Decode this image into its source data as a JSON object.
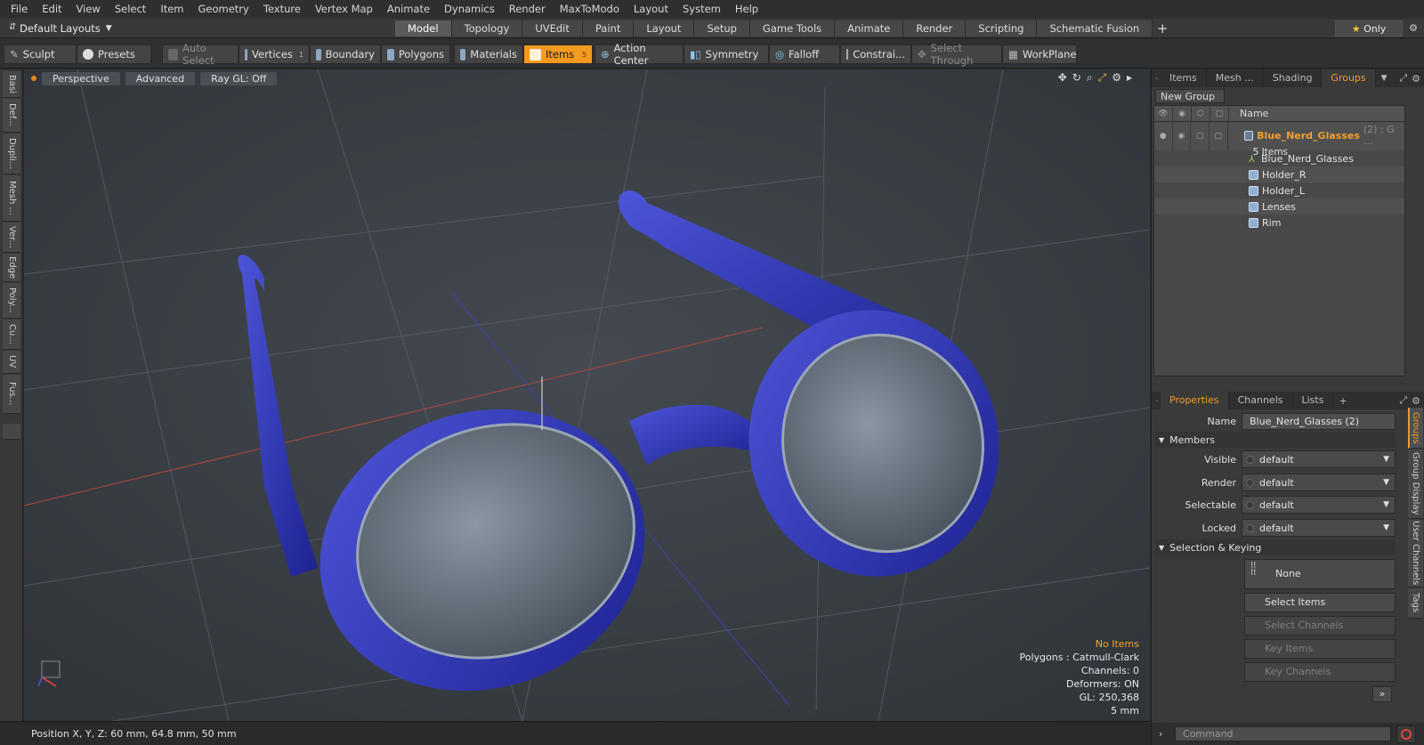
{
  "menu": [
    "File",
    "Edit",
    "View",
    "Select",
    "Item",
    "Geometry",
    "Texture",
    "Vertex Map",
    "Animate",
    "Dynamics",
    "Render",
    "MaxToModo",
    "Layout",
    "System",
    "Help"
  ],
  "layouts": {
    "label": "Default Layouts"
  },
  "mode_tabs": [
    "Model",
    "Topology",
    "UVEdit",
    "Paint",
    "Layout",
    "Setup",
    "Game Tools",
    "Animate",
    "Render",
    "Scripting",
    "Schematic Fusion"
  ],
  "only_label": "Only",
  "toolbar": {
    "sculpt": "Sculpt",
    "presets": "Presets",
    "auto_select": "Auto Select",
    "vertices": "Vertices",
    "vertices_count": "1",
    "boundary": "Boundary",
    "polygons": "Polygons",
    "materials": "Materials",
    "items": "Items",
    "items_count": "5",
    "action_center": "Action Center",
    "symmetry": "Symmetry",
    "falloff": "Falloff",
    "constraints": "Constrai...",
    "select_through": "Select Through",
    "workplane": "WorkPlane"
  },
  "left_tabs": [
    "Basi",
    "Def...",
    "Dupli...",
    "Mesh ...",
    "Ver...",
    "Edge",
    "Poly...",
    "Cu...",
    "UV",
    "Fus..."
  ],
  "viewport": {
    "tabs": [
      "Perspective",
      "Advanced",
      "Ray GL: Off"
    ],
    "info": {
      "no_items": "No Items",
      "polygons": "Polygons : Catmull-Clark",
      "channels": "Channels: 0",
      "deformers": "Deformers: ON",
      "gl": "GL: 250,368",
      "scale": "5 mm"
    }
  },
  "status": {
    "position": "Position X, Y, Z:  60 mm, 64.8 mm, 50 mm"
  },
  "panel_top": {
    "tabs": [
      "Items",
      "Mesh ...",
      "Shading",
      "Groups"
    ],
    "new_group": "New Group",
    "col_name": "Name",
    "group": {
      "name": "Blue_Nerd_Glasses",
      "suffix": "(2) : G ...",
      "count": "5 Items"
    },
    "items": [
      "Blue_Nerd_Glasses",
      "Holder_R",
      "Holder_L",
      "Lenses",
      "Rim"
    ]
  },
  "panel_bottom": {
    "tabs": [
      "Properties",
      "Channels",
      "Lists"
    ],
    "name_label": "Name",
    "name_value": "Blue_Nerd_Glasses (2)",
    "members": "Members",
    "visible_label": "Visible",
    "visible": "default",
    "render_label": "Render",
    "render": "default",
    "selectable_label": "Selectable",
    "selectable": "default",
    "locked_label": "Locked",
    "locked": "default",
    "sel_keying": "Selection & Keying",
    "none": "None",
    "select_items": "Select Items",
    "select_channels": "Select Channels",
    "key_items": "Key Items",
    "key_channels": "Key Channels",
    "side_tabs": [
      "Groups",
      "Group Display",
      "User Channels",
      "Tags"
    ]
  },
  "command": {
    "placeholder": "Command"
  },
  "colors": {
    "accent": "#f39a1f",
    "glasses": "#2a2fa8",
    "viewport_bg": "#3a4046"
  }
}
